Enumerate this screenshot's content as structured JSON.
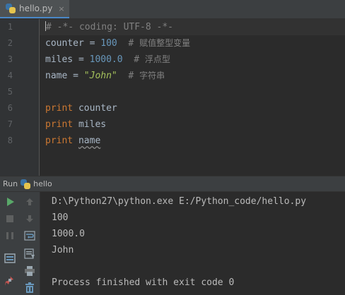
{
  "tab": {
    "filename": "hello.py",
    "close": "×",
    "icon": "python-file-icon"
  },
  "editor": {
    "line_numbers": [
      "1",
      "2",
      "3",
      "4",
      "5",
      "6",
      "7",
      "8"
    ],
    "lines": {
      "l1": {
        "text": "# -*- coding: UTF-8 -*-"
      },
      "l2": {
        "var": "counter",
        "op": " = ",
        "num": "100",
        "sp": "  ",
        "hash": "# ",
        "cmt": "赋值整型变量"
      },
      "l3": {
        "var": "miles",
        "op": " = ",
        "num": "1000.0",
        "sp": "  ",
        "hash": "# ",
        "cmt": "浮点型"
      },
      "l4": {
        "var": "name",
        "op": " = ",
        "str": "\"John\"",
        "sp": "  ",
        "hash": "# ",
        "cmt": "字符串"
      },
      "l6": {
        "kw": "print",
        "arg": " counter"
      },
      "l7": {
        "kw": "print",
        "arg": " miles"
      },
      "l8": {
        "kw": "print",
        "arg": " ",
        "arg2": "name"
      }
    }
  },
  "run_panel": {
    "label": "Run",
    "config": "hello",
    "config_icon": "python-icon"
  },
  "console": {
    "command": "D:\\Python27\\python.exe E:/Python_code/hello.py",
    "output": [
      "100",
      "1000.0",
      "John"
    ],
    "finish": "Process finished with exit code 0"
  },
  "toolbar_icons": {
    "left": [
      "run-icon",
      "stop-icon",
      "pause-icon",
      "layout-icon",
      "pin-icon"
    ],
    "right": [
      "up-arrow-icon",
      "down-arrow-icon",
      "soft-wrap-icon",
      "scroll-to-end-icon",
      "print-icon",
      "trash-icon"
    ]
  },
  "colors": {
    "keyword": "#cc7832",
    "number": "#6897bb",
    "string": "#a5c25c",
    "comment": "#808080",
    "run_green": "#59a869"
  }
}
